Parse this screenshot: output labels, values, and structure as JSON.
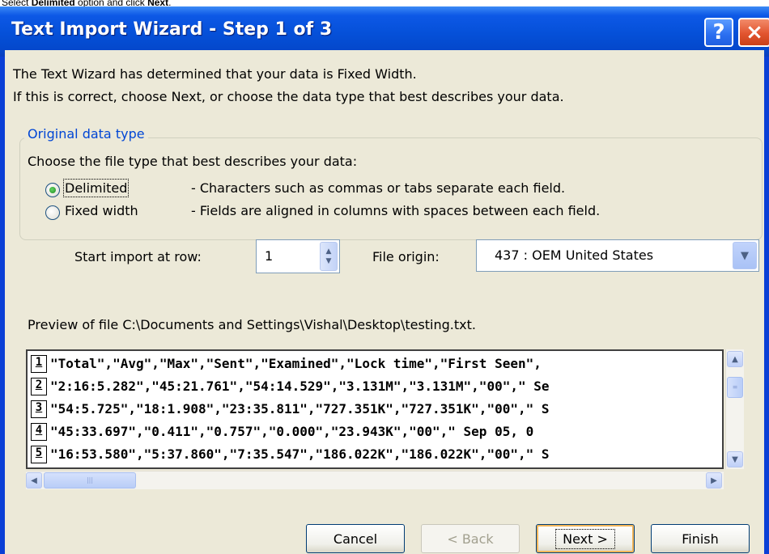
{
  "caption": {
    "prefix": "Select ",
    "bold1": "Delimited",
    "middle": " option and click ",
    "bold2": "Next",
    "suffix": "."
  },
  "window": {
    "title": "Text Import Wizard - Step 1 of 3",
    "help_glyph": "?",
    "close_glyph": "×"
  },
  "intro": {
    "line1": "The Text Wizard has determined that your data is Fixed Width.",
    "line2": "If this is correct, choose Next, or choose the data type that best describes your data."
  },
  "original_data_type": {
    "legend": "Original data type",
    "prompt": "Choose the file type that best describes your data:",
    "options": [
      {
        "label": "Delimited",
        "description": "- Characters such as commas or tabs separate each field.",
        "selected": true
      },
      {
        "label": "Fixed width",
        "description": "- Fields are aligned in columns with spaces between each field.",
        "selected": false
      }
    ]
  },
  "start_row": {
    "label": "Start import at row:",
    "value": "1"
  },
  "file_origin": {
    "label": "File origin:",
    "value": "437 : OEM United States"
  },
  "preview": {
    "label": "Preview of file C:\\Documents and Settings\\Vishal\\Desktop\\testing.txt.",
    "rows": [
      {
        "num": "1",
        "text": "\"Total\",\"Avg\",\"Max\",\"Sent\",\"Examined\",\"Lock time\",\"First Seen\","
      },
      {
        "num": "2",
        "text": "\"2:16:5.282\",\"45:21.761\",\"54:14.529\",\"3.131M\",\"3.131M\",\"00\",\" Se"
      },
      {
        "num": "3",
        "text": "\"54:5.725\",\"18:1.908\",\"23:35.811\",\"727.351K\",\"727.351K\",\"00\",\" S"
      },
      {
        "num": "4",
        "text": "\"45:33.697\",\"0.411\",\"0.757\",\"0.000\",\"23.943K\",\"00\",\" Sep  05, 0"
      },
      {
        "num": "5",
        "text": "\"16:53.580\",\"5:37.860\",\"7:35.547\",\"186.022K\",\"186.022K\",\"00\",\" S"
      }
    ]
  },
  "buttons": {
    "cancel": "Cancel",
    "back": "< Back",
    "next": "Next >",
    "finish": "Finish"
  }
}
